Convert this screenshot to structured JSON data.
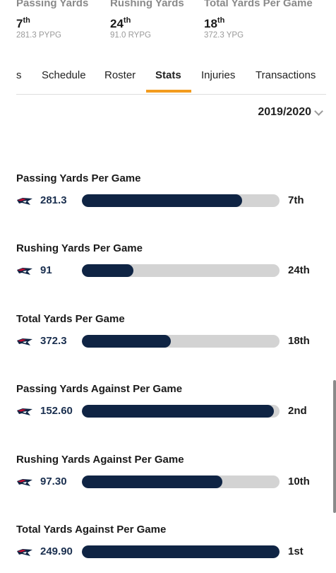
{
  "summary": [
    {
      "label": "Passing Yards",
      "rank": "7",
      "suffix": "th",
      "sub": "281.3 PYPG"
    },
    {
      "label": "Rushing Yards",
      "rank": "24",
      "suffix": "th",
      "sub": "91.0 RYPG"
    },
    {
      "label": "Total Yards Per Game",
      "rank": "18",
      "suffix": "th",
      "sub": "372.3 YPG"
    }
  ],
  "tabs": [
    {
      "label": "s"
    },
    {
      "label": "Schedule"
    },
    {
      "label": "Roster"
    },
    {
      "label": "Stats",
      "active": true
    },
    {
      "label": "Injuries"
    },
    {
      "label": "Transactions"
    }
  ],
  "season": {
    "label": "2019/2020"
  },
  "colors": {
    "accent": "#f39c1f",
    "bar_fill": "#0f2444",
    "bar_track": "#d3d3d3",
    "team_navy": "#0f2444",
    "team_red": "#c60c30"
  },
  "team_logo_icon": "patriots-logo-icon",
  "stats": [
    {
      "title": "Passing Yards Per Game",
      "value": "281.3",
      "rank": "7th",
      "fill": 0.81
    },
    {
      "title": "Rushing Yards Per Game",
      "value": "91",
      "rank": "24th",
      "fill": 0.26
    },
    {
      "title": "Total Yards Per Game",
      "value": "372.3",
      "rank": "18th",
      "fill": 0.45
    },
    {
      "title": "Passing Yards Against Per Game",
      "value": "152.60",
      "rank": "2nd",
      "fill": 0.97
    },
    {
      "title": "Rushing Yards Against Per Game",
      "value": "97.30",
      "rank": "10th",
      "fill": 0.71
    },
    {
      "title": "Total Yards Against Per Game",
      "value": "249.90",
      "rank": "1st",
      "fill": 1.0
    }
  ]
}
